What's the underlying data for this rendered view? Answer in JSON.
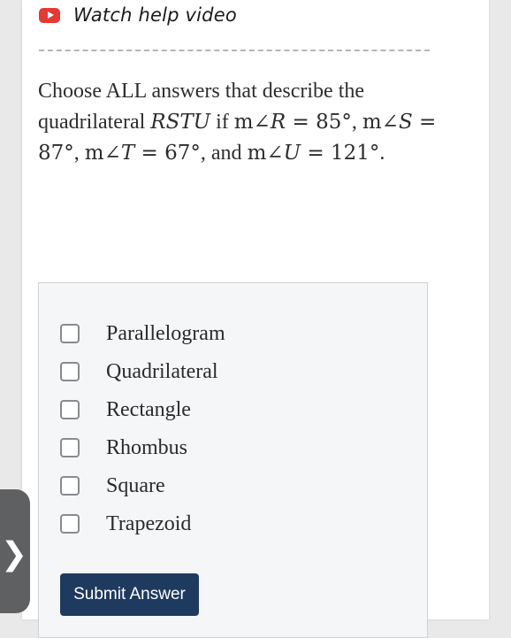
{
  "help": {
    "label": "Watch help video",
    "icon": "youtube-play-icon",
    "icon_color": "#e53935"
  },
  "question": {
    "intro": "Choose ALL answers that describe the quadrilateral",
    "figure": "RSTU",
    "connector": "if",
    "angle_prefix": "m∠",
    "angles": [
      {
        "vertex": "R",
        "value": "85°",
        "after": ","
      },
      {
        "vertex": "S",
        "value": "87°",
        "after": ","
      },
      {
        "vertex": "T",
        "value": "67°",
        "after": ", and"
      },
      {
        "vertex": "U",
        "value": "121°",
        "after": "."
      }
    ]
  },
  "options": [
    {
      "label": "Parallelogram",
      "checked": false
    },
    {
      "label": "Quadrilateral",
      "checked": false
    },
    {
      "label": "Rectangle",
      "checked": false
    },
    {
      "label": "Rhombus",
      "checked": false
    },
    {
      "label": "Square",
      "checked": false
    },
    {
      "label": "Trapezoid",
      "checked": false
    }
  ],
  "submit": {
    "label": "Submit Answer",
    "color": "#1e3a5f"
  },
  "side_tab": {
    "icon": "chevron-right-icon",
    "glyph": "❯"
  }
}
